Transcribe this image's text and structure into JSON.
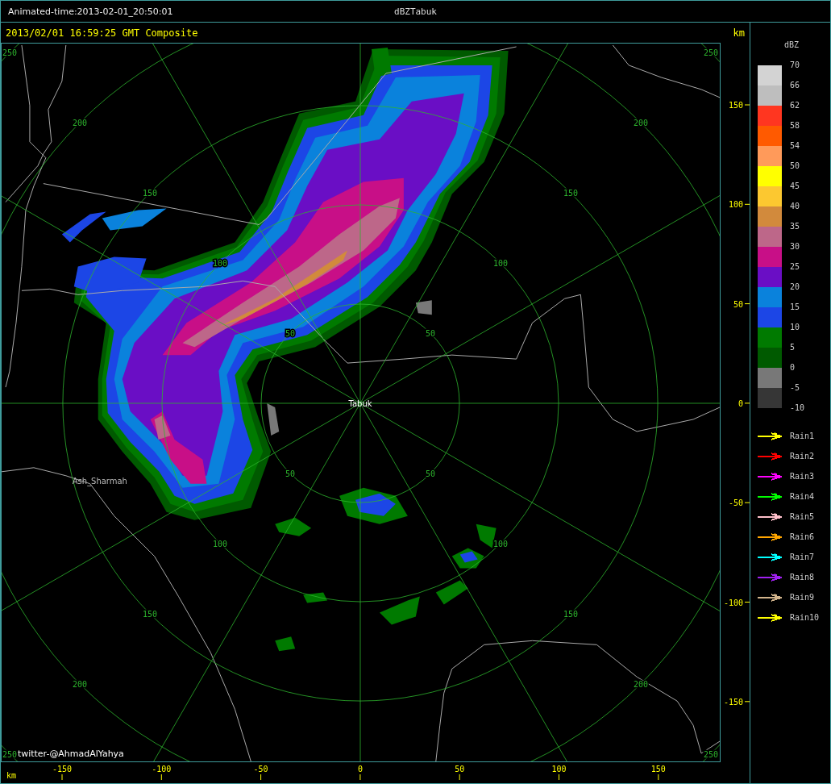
{
  "top_bar": {
    "animated_time": "Animated-time:2013-02-01_20:50:01",
    "title": "dBZTabuk"
  },
  "header": {
    "timestamp": "2013/02/01 16:59:25 GMT Composite",
    "unit": "km"
  },
  "map": {
    "ring_labels": [
      {
        "labels": [
          "50",
          "50",
          "50",
          "50"
        ]
      },
      {
        "labels": [
          "100",
          "100",
          "100",
          "100"
        ]
      },
      {
        "labels": [
          "150",
          "150",
          "150",
          "150"
        ]
      },
      {
        "labels": [
          "200",
          "200",
          "200",
          "200"
        ]
      },
      {
        "labels": [
          "250",
          "250",
          "250",
          "250"
        ]
      }
    ],
    "places": [
      {
        "kind": "station",
        "name": "Tabuk"
      },
      {
        "kind": "town",
        "name": "Ash_Sharmah"
      }
    ],
    "credit": "twitter-@AhmadAlYahya"
  },
  "y_axis": {
    "ticks": [
      "150",
      "100",
      "50",
      "0",
      "-50",
      "-100",
      "-150"
    ]
  },
  "x_axis": {
    "unit": "km",
    "ticks": [
      "-150",
      "-100",
      "-50",
      "0",
      "50",
      "100",
      "150"
    ]
  },
  "legend": {
    "title": "dBZ",
    "bins": [
      {
        "color": "#d3d3d3",
        "label": "70"
      },
      {
        "color": "#bebebe",
        "label": "66"
      },
      {
        "color": "#ff3620",
        "label": "62"
      },
      {
        "color": "#ff5a00",
        "label": "58"
      },
      {
        "color": "#ff9a5a",
        "label": "54"
      },
      {
        "color": "#ffff00",
        "label": "50"
      },
      {
        "color": "#fcc830",
        "label": "45"
      },
      {
        "color": "#d28a3c",
        "label": "40"
      },
      {
        "color": "#bd6789",
        "label": "35"
      },
      {
        "color": "#c80f87",
        "label": "30"
      },
      {
        "color": "#6a0ec5",
        "label": "25"
      },
      {
        "color": "#0a82dc",
        "label": "20"
      },
      {
        "color": "#1c46e6",
        "label": "15"
      },
      {
        "color": "#007a00",
        "label": "10"
      },
      {
        "color": "#005a00",
        "label": "5"
      },
      {
        "color": "#787878",
        "label": "0"
      },
      {
        "color": "#363636",
        "label": "-5"
      }
    ],
    "bottom_label": "-10",
    "tracks": [
      {
        "color": "#ffff00",
        "label": "Rain1"
      },
      {
        "color": "#ff0000",
        "label": "Rain2"
      },
      {
        "color": "#ff00ff",
        "label": "Rain3"
      },
      {
        "color": "#00ff00",
        "label": "Rain4"
      },
      {
        "color": "#ffc0cb",
        "label": "Rain5"
      },
      {
        "color": "#ffa500",
        "label": "Rain6"
      },
      {
        "color": "#00ffff",
        "label": "Rain7"
      },
      {
        "color": "#a020f0",
        "label": "Rain8"
      },
      {
        "color": "#d2b48c",
        "label": "Rain9"
      },
      {
        "color": "#ffff00",
        "label": "Rain10"
      }
    ]
  }
}
